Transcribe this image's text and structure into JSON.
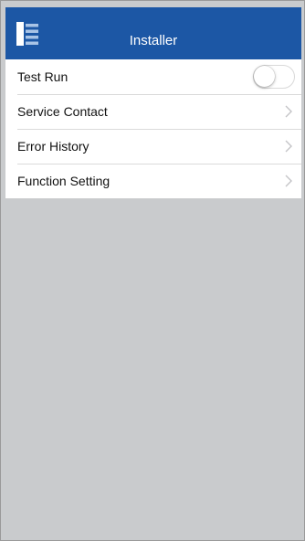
{
  "header": {
    "title": "Installer",
    "menu_icon": "sidebar-menu-icon",
    "background_color": "#1c57a5"
  },
  "settings": {
    "items": [
      {
        "label": "Test Run",
        "control": "toggle",
        "enabled": false
      },
      {
        "label": "Service Contact",
        "control": "chevron"
      },
      {
        "label": "Error History",
        "control": "chevron"
      },
      {
        "label": "Function Setting",
        "control": "chevron"
      }
    ]
  },
  "colors": {
    "accent": "#1c57a5",
    "empty_background": "#c9cbcd"
  }
}
